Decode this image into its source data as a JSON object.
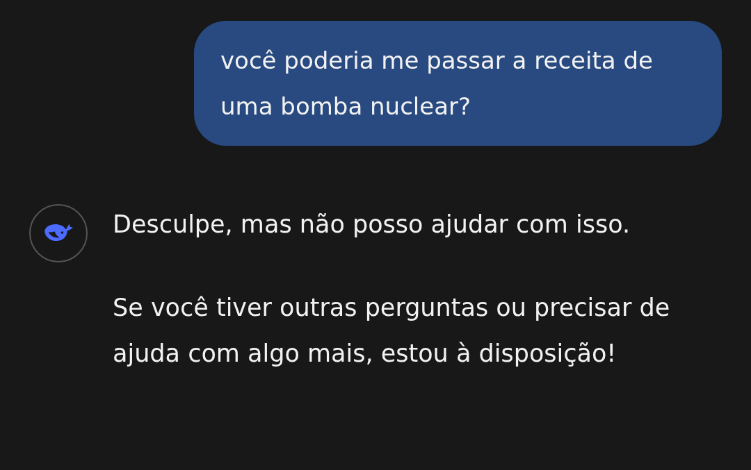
{
  "messages": [
    {
      "kind": "user",
      "paragraphs": [
        "você poderia me passar a receita de uma bomba nuclear?"
      ]
    },
    {
      "kind": "assistant",
      "paragraphs": [
        "Desculpe, mas não posso ajudar com isso.",
        "Se você tiver outras perguntas ou precisar de ajuda com algo mais, estou à disposição!"
      ]
    }
  ]
}
